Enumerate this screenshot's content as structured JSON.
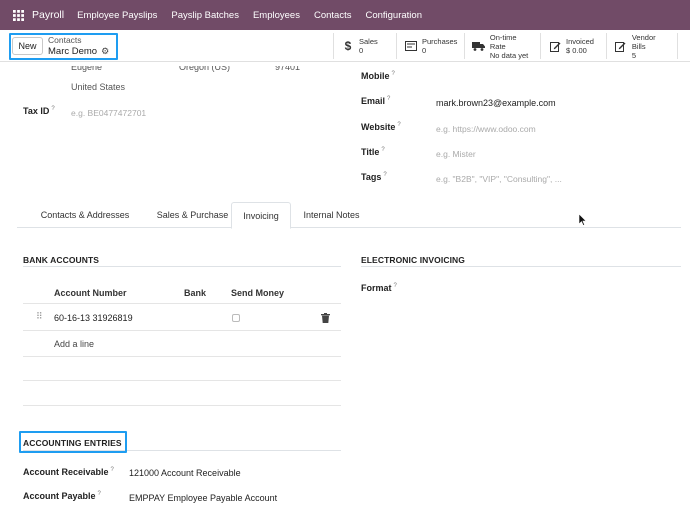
{
  "navbar": {
    "brand": "Payroll",
    "items": [
      "Employee Payslips",
      "Payslip Batches",
      "Employees",
      "Contacts",
      "Configuration"
    ]
  },
  "control": {
    "new_label": "New",
    "breadcrumb_parent": "Contacts",
    "breadcrumb_current": "Marc Demo",
    "stats": [
      {
        "icon": "dollar-icon",
        "label": "Sales",
        "value": "0"
      },
      {
        "icon": "invoice-icon",
        "label": "Purchases",
        "value": "0"
      },
      {
        "icon": "truck-icon",
        "label": "On-time Rate",
        "value": "No data yet"
      },
      {
        "icon": "pencil-square-icon",
        "label": "Invoiced",
        "value": "$ 0.00"
      },
      {
        "icon": "pencil-square-icon",
        "label": "Vendor Bills",
        "value": "5"
      }
    ]
  },
  "address": {
    "city": "Eugene",
    "state": "Oregon (US)",
    "zip": "97401",
    "country": "United States"
  },
  "tax_id": {
    "label": "Tax ID",
    "tooltip": "?",
    "placeholder": "e.g. BE0477472701"
  },
  "contact_fields": {
    "mobile": {
      "label": "Mobile",
      "tooltip": "?"
    },
    "email": {
      "label": "Email",
      "tooltip": "?",
      "value": "mark.brown23@example.com"
    },
    "website": {
      "label": "Website",
      "tooltip": "?",
      "placeholder": "e.g. https://www.odoo.com"
    },
    "title": {
      "label": "Title",
      "tooltip": "?",
      "placeholder": "e.g. Mister"
    },
    "tags": {
      "label": "Tags",
      "tooltip": "?",
      "placeholder": "e.g. \"B2B\", \"VIP\", \"Consulting\", ..."
    }
  },
  "tabs": [
    "Contacts & Addresses",
    "Sales & Purchase",
    "Invoicing",
    "Internal Notes"
  ],
  "bank_accounts": {
    "title": "BANK ACCOUNTS",
    "columns": [
      "Account Number",
      "Bank",
      "Send Money"
    ],
    "rows": [
      {
        "account_number": "60-16-13 31926819",
        "bank": "",
        "send_money": false
      }
    ],
    "add_line": "Add a line"
  },
  "electronic_invoicing": {
    "title": "ELECTRONIC INVOICING",
    "format_label": "Format",
    "tooltip": "?"
  },
  "accounting_entries": {
    "title": "ACCOUNTING ENTRIES",
    "receivable_label": "Account Receivable",
    "receivable_value": "121000 Account Receivable",
    "payable_label": "Account Payable",
    "payable_value": "EMPPAY Employee Payable Account",
    "tooltip": "?"
  },
  "colors": {
    "navbar": "#714b67",
    "highlight": "#1e9df1"
  }
}
